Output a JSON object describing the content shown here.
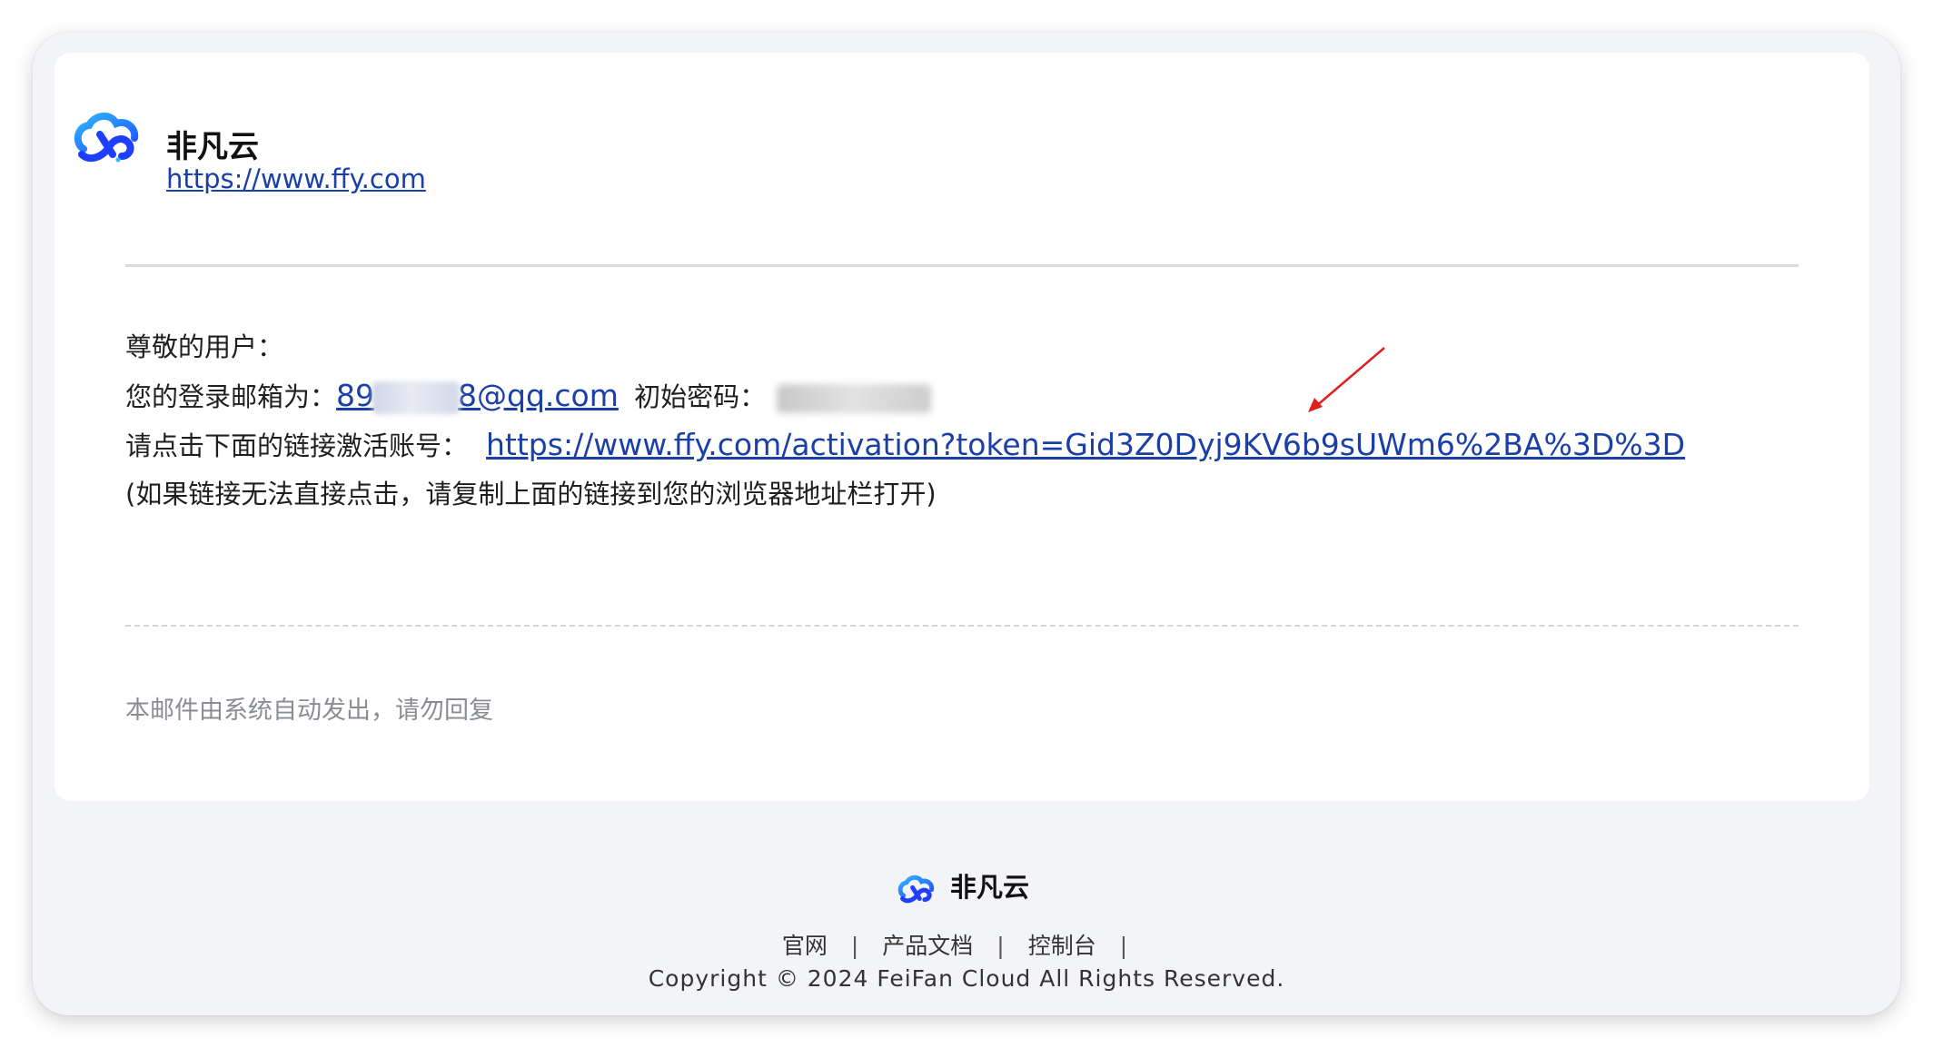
{
  "brand": {
    "name": "非凡云",
    "url": "https://www.ffy.com"
  },
  "greeting": "尊敬的用户：",
  "login_line": {
    "label": "您的登录邮箱为：",
    "email_prefix": "89",
    "email_suffix": "8@qq.com",
    "password_label": "初始密码："
  },
  "activation_line": {
    "label": "请点击下面的链接激活账号：",
    "link": "https://www.ffy.com/activation?token=Gid3Z0Dyj9KV6b9sUWm6%2BA%3D%3D"
  },
  "fallback_note": "(如果链接无法直接点击，请复制上面的链接到您的浏览器地址栏打开)",
  "auto_note": "本邮件由系统自动发出，请勿回复",
  "footer": {
    "brand_name": "非凡云",
    "nav": [
      "官网",
      "产品文档",
      "控制台"
    ],
    "separator": "|",
    "copyright": "Copyright © 2024 FeiFan Cloud All Rights Reserved."
  },
  "colors": {
    "link": "#1a3fa8",
    "logo_blue": "#1f5eff",
    "logo_cyan": "#2fb6ff",
    "annotation_arrow": "#e02020",
    "frame_bg": "#f3f4f7"
  }
}
